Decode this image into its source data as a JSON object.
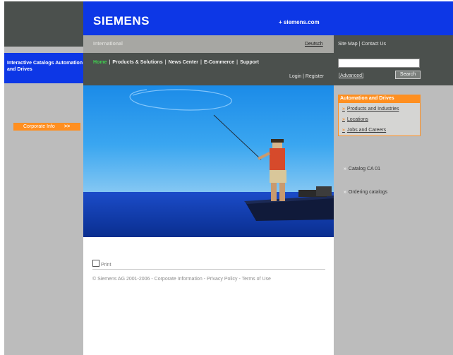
{
  "brand": {
    "logo": "SIEMENS",
    "site_link": "+ siemens.com"
  },
  "topbar": {
    "international": "International",
    "language_link": "Deutsch",
    "sitemap": "Site Map | Contact Us"
  },
  "left": {
    "title": "Interactive Catalogs Automation and Drives",
    "corporate_info": "Corporate Info",
    "corporate_arrow": ">>"
  },
  "nav": {
    "items": [
      "Home",
      "Products & Solutions",
      "News Center",
      "E-Commerce",
      "Support"
    ],
    "separator": "|",
    "login": "Login | Register"
  },
  "search": {
    "placeholder": "",
    "advanced": "[Advanced]",
    "button": "Search"
  },
  "automation_box": {
    "title": "Automation and Drives",
    "bullet": "»",
    "links": [
      "Products and Industries",
      "Locations",
      "Jobs and Careers"
    ]
  },
  "catalogs": {
    "bullet": "»",
    "items": [
      "Catalog CA 01",
      "Ordering catalogs"
    ]
  },
  "content": {
    "print": "Print",
    "footer": "© Siemens AG 2001-2006 - Corporate Information - Privacy Policy - Terms of Use"
  },
  "colors": {
    "siemens_blue": "#0d37e6",
    "dark_gray": "#4b504d",
    "orange": "#ff8f20",
    "home_green": "#3fd14e"
  }
}
